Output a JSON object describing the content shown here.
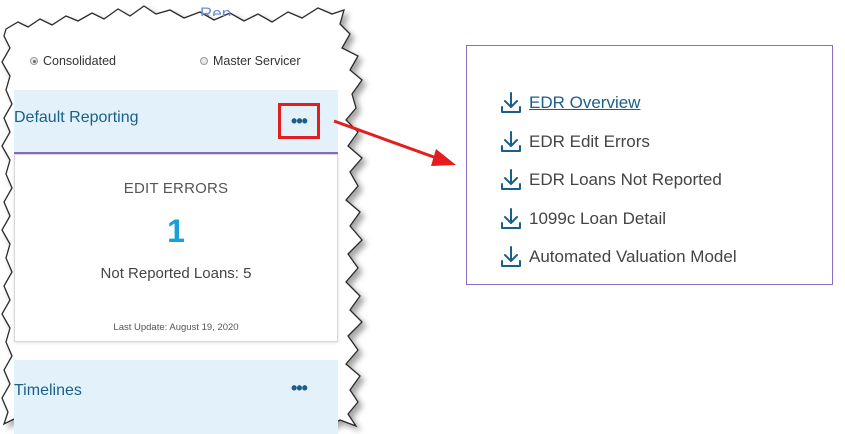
{
  "panel": {
    "partial_header": "Rep",
    "view_options": [
      {
        "label": "Consolidated",
        "checked": true
      },
      {
        "label": "Master Servicer",
        "checked": false
      }
    ],
    "cards": [
      {
        "title": "Default Reporting",
        "more_label": "•••",
        "metric_label": "EDIT ERRORS",
        "metric_value": "1",
        "sub_metric": "Not Reported Loans: 5",
        "last_update": "Last Update: August 19, 2020"
      },
      {
        "title": "Timelines",
        "more_label": "•••"
      }
    ]
  },
  "menu": {
    "items": [
      {
        "label": "EDR Overview",
        "icon": "download-icon",
        "hovered": true
      },
      {
        "label": "EDR Edit Errors",
        "icon": "download-icon"
      },
      {
        "label": "EDR Loans Not Reported",
        "icon": "download-icon"
      },
      {
        "label": "1099c Loan Detail",
        "icon": "download-icon"
      },
      {
        "label": "Automated Valuation Model",
        "icon": "download-icon"
      }
    ]
  },
  "colors": {
    "accent": "#1a5f8a",
    "metric": "#17a1d8",
    "highlight_box": "#e41e1e",
    "arrow": "#e41e1e",
    "divider": "#8a6bbf",
    "card_header_bg": "#e3f2fa"
  }
}
